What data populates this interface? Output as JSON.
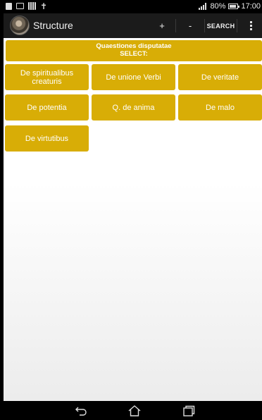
{
  "status_bar": {
    "battery_percent": "80%",
    "time": "17:00"
  },
  "action_bar": {
    "title": "Structure",
    "plus_label": "+",
    "minus_label": "-",
    "search_label": "SEARCH"
  },
  "header": {
    "line1": "Quaestiones disputatae",
    "line2": "SELECT:"
  },
  "items": [
    "De spiritualibus creaturis",
    "De unione Verbi",
    "De veritate",
    "De potentia",
    "Q. de anima",
    "De malo",
    "De virtutibus"
  ],
  "colors": {
    "accent": "#d8ad06",
    "action_bar": "#1b1b1b"
  }
}
